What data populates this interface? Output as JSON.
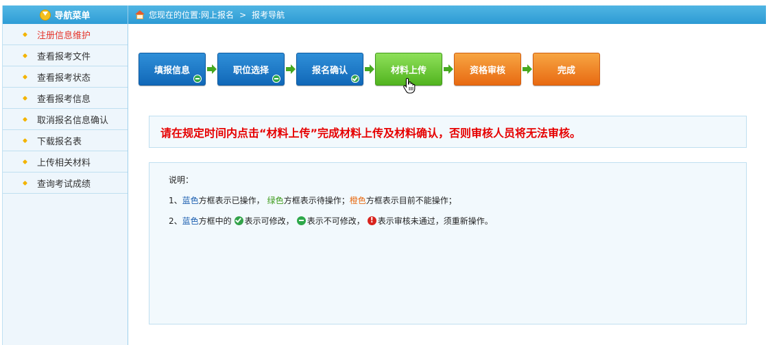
{
  "sidebar": {
    "title": "导航菜单",
    "items": [
      {
        "label": "注册信息维护"
      },
      {
        "label": "查看报考文件"
      },
      {
        "label": "查看报考状态"
      },
      {
        "label": "查看报考信息"
      },
      {
        "label": "取消报名信息确认"
      },
      {
        "label": "下载报名表"
      },
      {
        "label": "上传相关材料"
      },
      {
        "label": "查询考试成绩"
      }
    ]
  },
  "breadcrumb": {
    "prefix": "您现在的位置:",
    "level1": "网上报名",
    "separator": ">",
    "level2": "报考导航"
  },
  "steps": [
    {
      "label": "填报信息",
      "color": "blue",
      "badge": "minus"
    },
    {
      "label": "职位选择",
      "color": "blue",
      "badge": "minus"
    },
    {
      "label": "报名确认",
      "color": "blue",
      "badge": "check"
    },
    {
      "label": "材料上传",
      "color": "green",
      "badge": "none"
    },
    {
      "label": "资格审核",
      "color": "orange",
      "badge": "none"
    },
    {
      "label": "完成",
      "color": "orange",
      "badge": "none"
    }
  ],
  "notice": "请在规定时间内点击“材料上传”完成材料上传及材料确认，否则审核人员将无法审核。",
  "info": {
    "title": "说明：",
    "line1": {
      "prefix": "1、",
      "blue": "蓝色",
      "blue_text": "方框表示已操作，",
      "green": "绿色",
      "green_text": "方框表示待操作；",
      "orange": "橙色",
      "orange_text": "方框表示目前不能操作；"
    },
    "line2": {
      "prefix": "2、",
      "blue": "蓝色",
      "text1": "方框中的",
      "check_text": "表示可修改，",
      "minus_text": "表示不可修改，",
      "excl_text": "表示审核未通过，须重新操作。"
    }
  },
  "colors": {
    "header_bg": "#2e9dd6",
    "step_blue": "#1168b8",
    "step_green": "#52b41f",
    "step_orange": "#e86a12",
    "notice_text": "#e60000",
    "active_menu_text": "#e5342a"
  }
}
